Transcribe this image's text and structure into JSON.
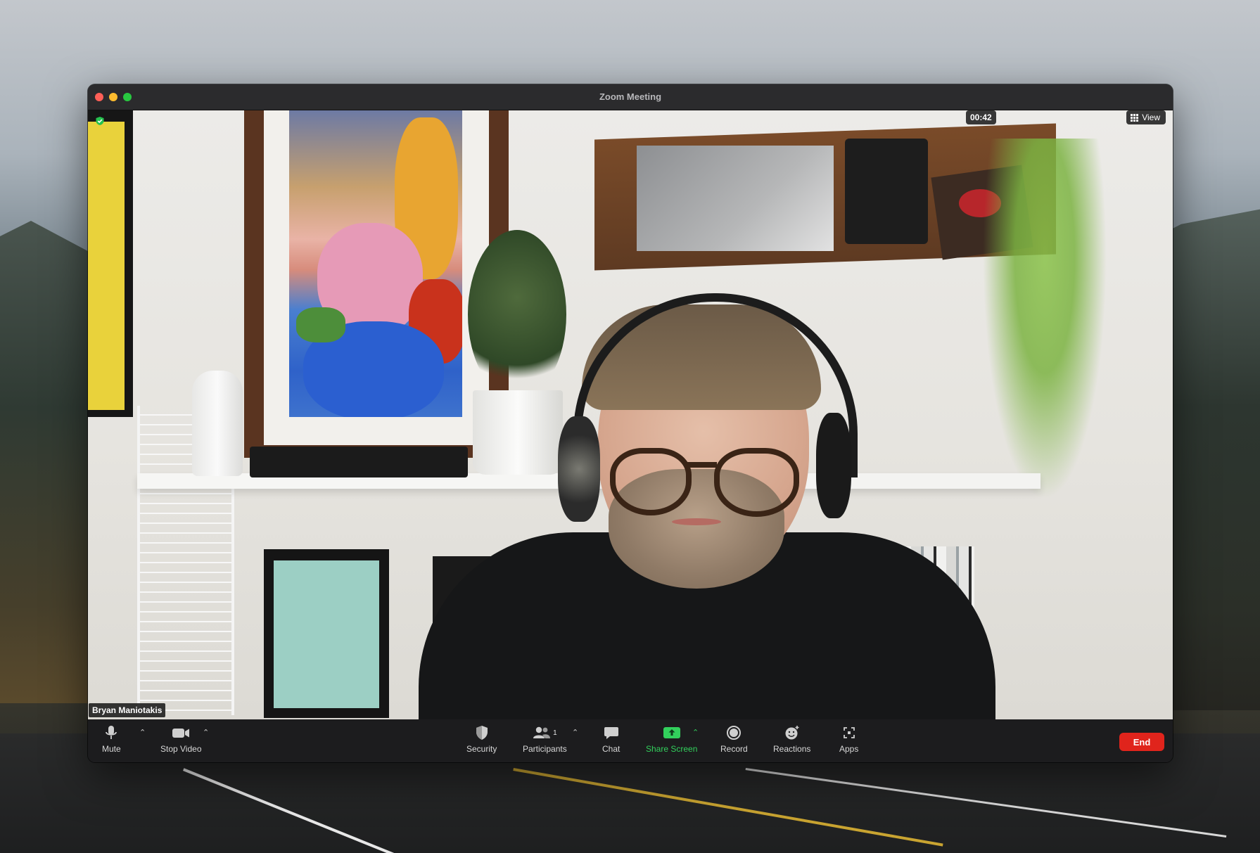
{
  "window": {
    "title": "Zoom Meeting"
  },
  "meeting": {
    "timer": "00:42",
    "view_label": "View",
    "participant_name": "Bryan Maniotakis"
  },
  "toolbar": {
    "mute_label": "Mute",
    "stop_video_label": "Stop Video",
    "security_label": "Security",
    "participants_label": "Participants",
    "participants_count": "1",
    "chat_label": "Chat",
    "share_screen_label": "Share Screen",
    "record_label": "Record",
    "reactions_label": "Reactions",
    "apps_label": "Apps",
    "end_label": "End"
  },
  "colors": {
    "share_green": "#32d05c",
    "end_red": "#e0241c",
    "toolbar_bg": "#1c1c1e"
  },
  "icons": {
    "mute": "microphone-icon",
    "video": "video-camera-icon",
    "security": "shield-icon",
    "participants": "people-icon",
    "chat": "chat-bubble-icon",
    "share": "share-screen-icon",
    "record": "record-icon",
    "reactions": "smiley-icon",
    "apps": "apps-icon",
    "view": "grid-icon",
    "encryption": "shield-check-icon"
  }
}
